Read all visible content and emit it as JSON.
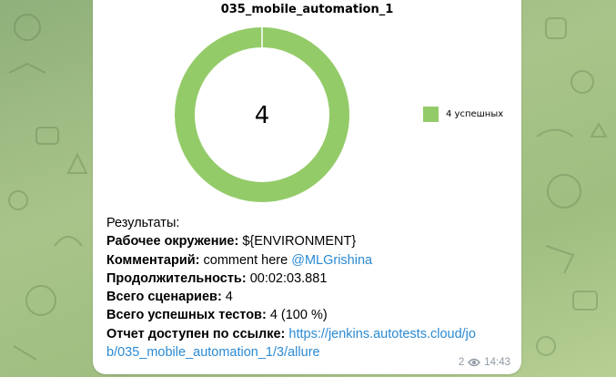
{
  "background": {
    "pattern_color": "#6e8f5c"
  },
  "chart": {
    "title": "035_mobile_automation_1",
    "center_value": "4",
    "legend_label": "4 успешных"
  },
  "chart_data": {
    "type": "pie",
    "title": "035_mobile_automation_1",
    "categories": [
      "4 успешных"
    ],
    "values": [
      4
    ],
    "colors": [
      "#94cb69"
    ],
    "donut": true,
    "center_label": "4",
    "legend_position": "right"
  },
  "message": {
    "results_label": "Результаты:",
    "env_label": "Рабочее окружение:",
    "env_value": " ${ENVIRONMENT}",
    "comment_label": "Комментарий:",
    "comment_value": " comment here ",
    "comment_mention": "@MLGrishina",
    "duration_label": "Продолжительность:",
    "duration_value": " 00:02:03.881",
    "scenarios_label": "Всего сценариев:",
    "scenarios_value": " 4",
    "passed_label": "Всего успешных тестов:",
    "passed_value": " 4 (100 %)",
    "report_label": "Отчет доступен по ссылке:",
    "report_link_line1": " https://jenkins.autotests.cloud/jo",
    "report_link_line2": "b/035_mobile_automation_1/3/allure"
  },
  "meta": {
    "views": "2",
    "time": "14:43",
    "icon": "eye-icon"
  },
  "colors": {
    "success": "#94cb69",
    "link": "#2b8ad3",
    "meta_text": "#8f9aa3"
  }
}
